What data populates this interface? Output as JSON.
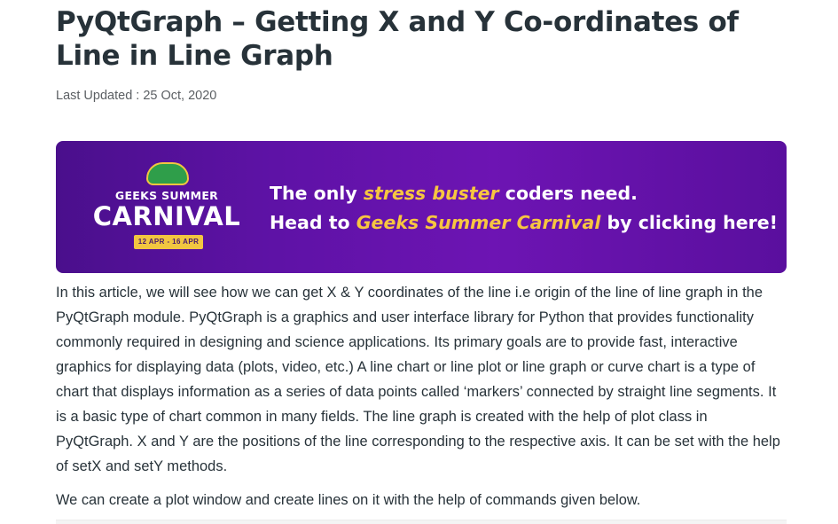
{
  "article": {
    "title": "PyQtGraph – Getting X and Y Co-ordinates of Line in Line Graph",
    "last_updated": "Last Updated : 25 Oct, 2020"
  },
  "banner": {
    "logo": {
      "top_text": "GEEKS SUMMER",
      "main_text": "CARNIVAL",
      "dates": "12 APR - 16 APR"
    },
    "line1_a": "The only ",
    "line1_highlight": "stress buster",
    "line1_b": " coders need.",
    "line2_a": "Head to ",
    "line2_highlight": "Geeks Summer Carnival",
    "line2_b": " by clicking here!",
    "colors": {
      "background": "#5e12a6",
      "highlight": "#f7c640"
    }
  },
  "paragraphs": [
    "In this article, we will see how we can get X & Y coordinates of the line i.e origin of the line of line graph in the PyQtGraph module. PyQtGraph is a graphics and user interface library for Python that provides functionality commonly required in designing and science applications. Its primary goals are to provide fast, interactive graphics for displaying data (plots, video, etc.) A line chart or line plot or line graph or curve chart is a type of chart that displays information as a series of data points called ‘markers’ connected by straight line segments. It is a basic type of chart common in many fields. The line graph is created with the help of plot class in PyQtGraph. X and Y are the positions of the line corresponding to the respective axis. It can be set with the help of setX and setY methods.",
    "We can create a plot window and create lines on it with the help of commands given below."
  ]
}
